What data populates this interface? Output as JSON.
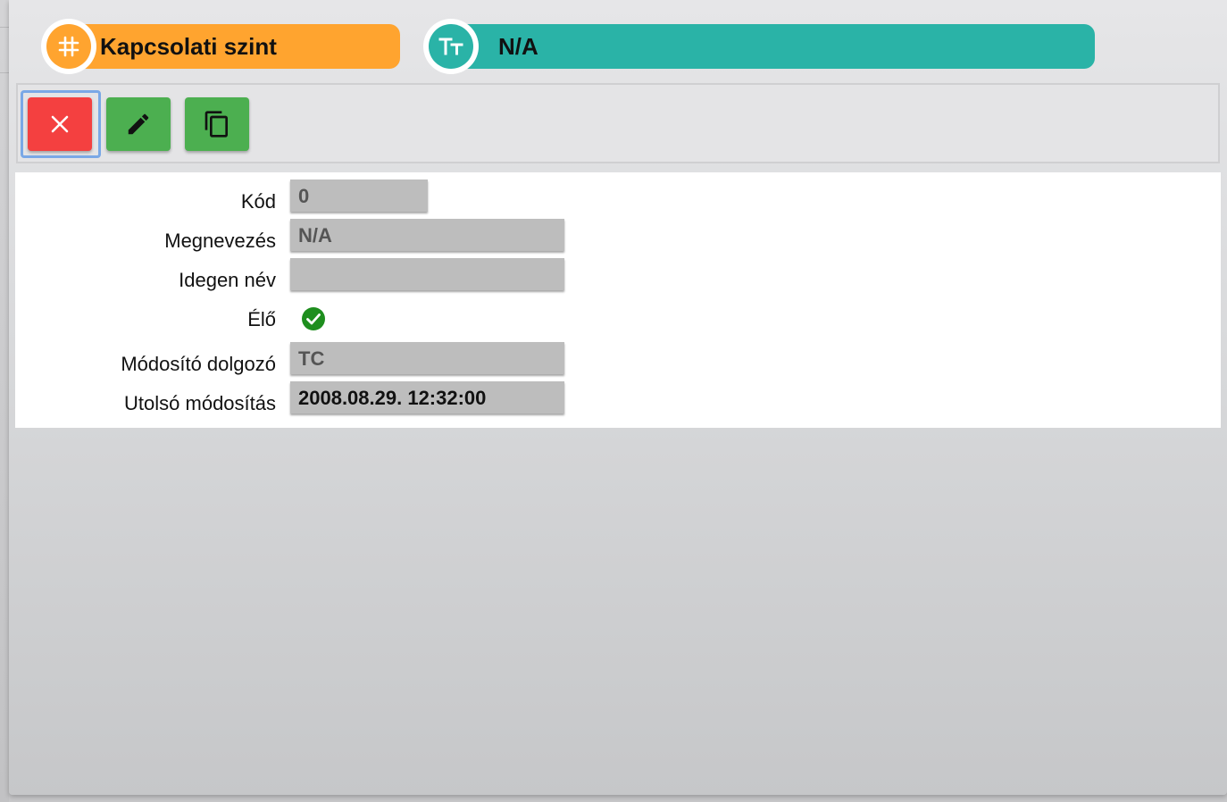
{
  "header": {
    "category_pill": {
      "label": "Kapcsolati szint",
      "icon": "hash-icon",
      "color": "#ffa42f"
    },
    "name_pill": {
      "label": "N/A",
      "icon": "text-type-icon",
      "color": "#2ab3a7"
    }
  },
  "toolbar": {
    "close": {
      "icon": "close-icon",
      "color": "#f44040"
    },
    "edit": {
      "icon": "pencil-icon",
      "color": "#4caf50"
    },
    "copy": {
      "icon": "copy-icon",
      "color": "#4caf50"
    }
  },
  "form": {
    "kod": {
      "label": "Kód",
      "value": "0"
    },
    "megnevezes": {
      "label": "Megnevezés",
      "value": "N/A"
    },
    "idegen_nev": {
      "label": "Idegen név",
      "value": ""
    },
    "elo": {
      "label": "Élő",
      "checked": true,
      "icon": "check-circle-icon",
      "color": "#1e8e1e"
    },
    "modosito": {
      "label": "Módosító dolgozó",
      "value": "TC"
    },
    "utolso": {
      "label": "Utolsó módosítás",
      "value": "2008.08.29. 12:32:00"
    }
  }
}
